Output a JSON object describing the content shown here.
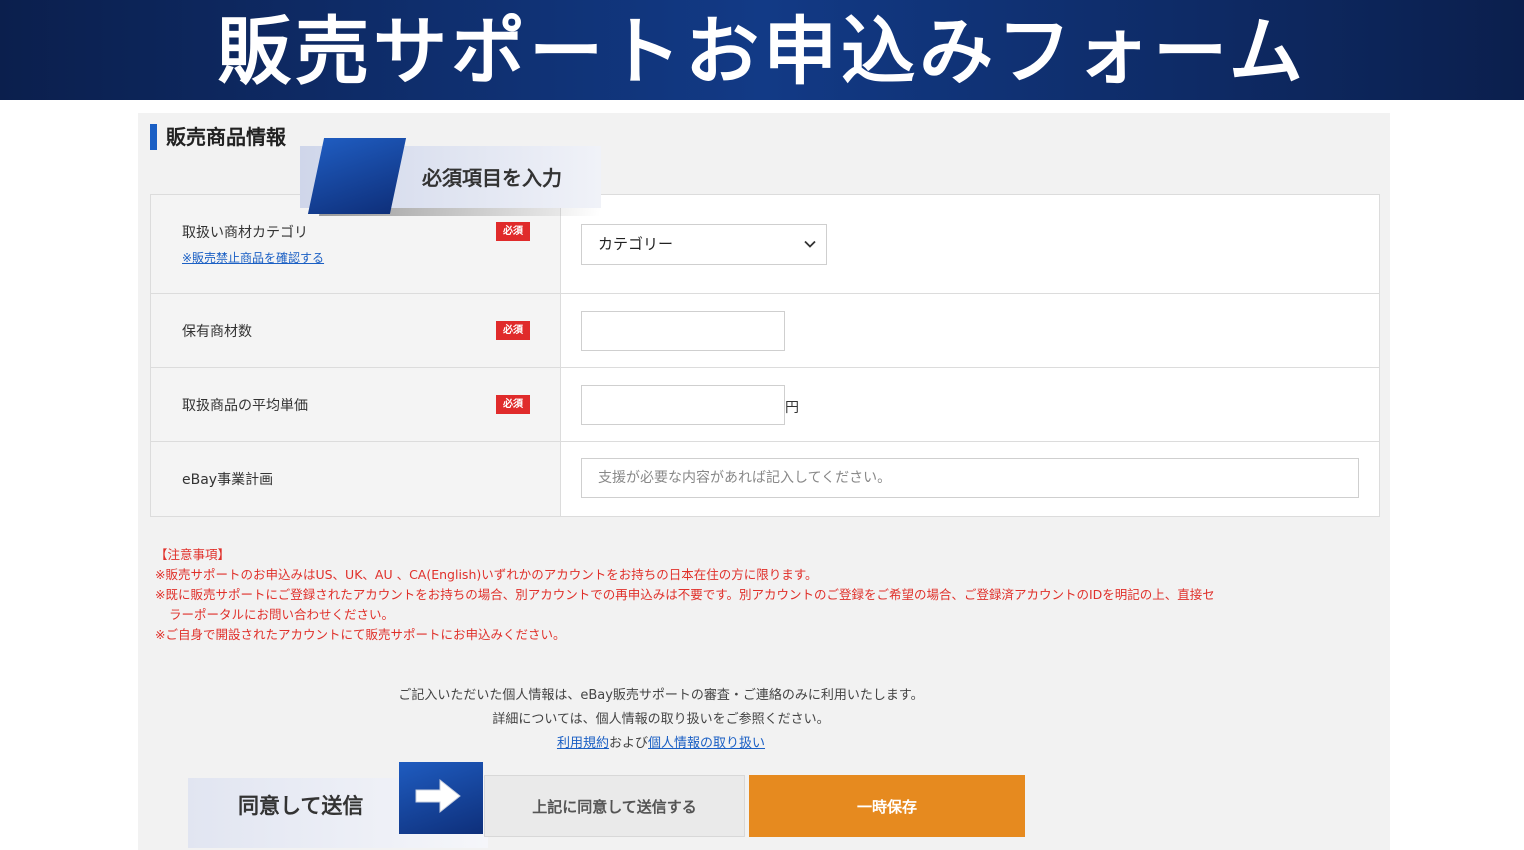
{
  "banner": {
    "title": "販売サポートお申込みフォーム"
  },
  "section": {
    "title": "販売商品情報"
  },
  "callout": {
    "text": "必須項目を入力"
  },
  "required_badge": "必須",
  "form": {
    "category": {
      "label": "取扱い商材カテゴリ",
      "link": "※販売禁止商品を確認する",
      "selected": "カテゴリー"
    },
    "stock_count": {
      "label": "保有商材数",
      "value": ""
    },
    "avg_price": {
      "label": "取扱商品の平均単価",
      "value": "",
      "unit": "円"
    },
    "business_plan": {
      "label": "eBay事業計画",
      "placeholder": "支援が必要な内容があれば記入してください。"
    }
  },
  "notes": {
    "heading": "【注意事項】",
    "line1": "※販売サポートのお申込みはUS、UK、AU 、CA(English)いずれかのアカウントをお持ちの日本在住の方に限ります。",
    "line2a": "※既に販売サポートにご登録されたアカウントをお持ちの場合、別アカウントでの再申込みは不要です。別アカウントのご登録をご希望の場合、ご登録済アカウントのIDを明記の上、直接セ",
    "line2b": "ラーポータルにお問い合わせください。",
    "line3": "※ご自身で開設されたアカウントにて販売サポートにお申込みください。"
  },
  "privacy": {
    "line1": "ご記入いただいた個人情報は、eBay販売サポートの審査・ご連絡のみに利用いたします。",
    "line2": "詳細については、個人情報の取り扱いをご参照ください。",
    "terms_link": "利用規約",
    "and": "および",
    "privacy_link": "個人情報の取り扱い"
  },
  "agree_callout": {
    "text": "同意して送信"
  },
  "buttons": {
    "agree_submit": "上記に同意して送信する",
    "temp_save": "一時保存"
  },
  "colors": {
    "banner": "#123a86",
    "accent_blue": "#1a5fc4",
    "required_red": "#e02b2b",
    "save_orange": "#e68a1f"
  }
}
